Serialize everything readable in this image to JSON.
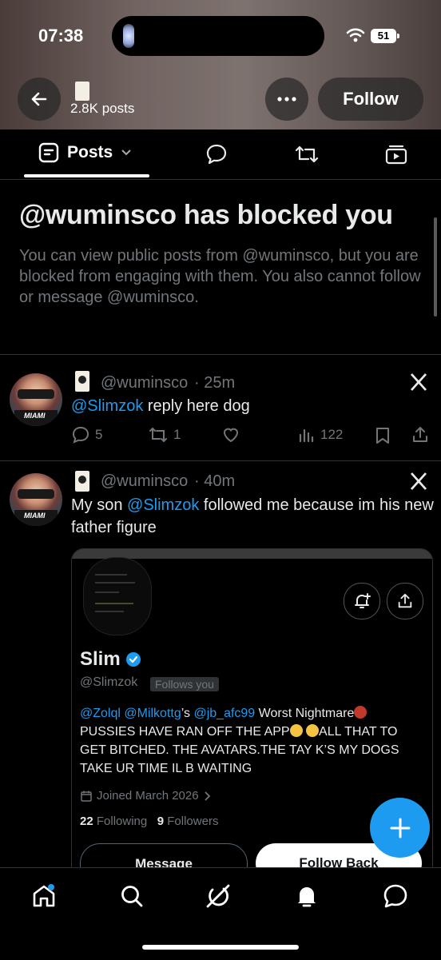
{
  "status_bar": {
    "time": "07:38",
    "battery": "51"
  },
  "header": {
    "posts_count": "2.8K posts",
    "follow_label": "Follow"
  },
  "tabs": {
    "posts_label": "Posts"
  },
  "blocked": {
    "title": "@wuminsco has blocked you",
    "message": "You can view public posts from @wuminsco, but you are blocked from engaging with them. You also cannot follow or message @wuminsco."
  },
  "posts": [
    {
      "handle": "@wuminsco",
      "time": "· 25m",
      "mention": "@Slimzok",
      "text_after": " reply here dog",
      "replies": "5",
      "reposts": "1",
      "views": "122"
    },
    {
      "handle": "@wuminsco",
      "time": "· 40m",
      "text_before": "My son ",
      "mention": "@Slimzok",
      "text_after": " followed me because im his new father figure"
    }
  ],
  "embedded_profile": {
    "name": "Slim",
    "handle": "@Slimzok",
    "follows_you": "Follows you",
    "bio_mentions": [
      "@Zolql",
      "@Milkottg",
      "@jb_afc99"
    ],
    "bio_sep": "’s ",
    "bio_text_1": " Worst Nightmare",
    "bio_text_2": "PUSSIES HAVE RAN OFF THE APP",
    "bio_text_3": "ALL THAT TO GET BITCHED. THE AVATARS.THE TAY K’S MY DOGS TAKE UR TIME IL B WAITING",
    "joined": "Joined March 2026",
    "following_count": "22",
    "following_label": "Following",
    "followers_count": "9",
    "followers_label": "Followers",
    "message_label": "Message",
    "follow_back_label": "Follow Back"
  },
  "colors": {
    "accent": "#1d9bf0",
    "muted": "#71767b",
    "text": "#e7e9ea",
    "background": "#000000"
  },
  "icons": [
    "back-arrow-icon",
    "more-icon",
    "posts-icon",
    "chevron-down-icon",
    "replies-tab-icon",
    "reposts-tab-icon",
    "media-tab-icon",
    "x-logo-icon",
    "reply-icon",
    "repost-icon",
    "like-icon",
    "views-icon",
    "bookmark-icon",
    "share-icon",
    "notify-add-icon",
    "verified-icon",
    "calendar-icon",
    "plus-icon",
    "home-icon",
    "search-icon",
    "grok-icon",
    "bell-icon",
    "messages-icon"
  ]
}
